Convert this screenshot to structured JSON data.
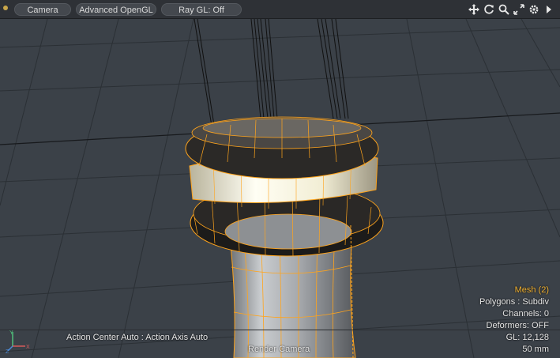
{
  "toolbar": {
    "camera_label": "Camera",
    "shading_label": "Advanced OpenGL",
    "raygl_label": "Ray GL: Off",
    "nav_icons": [
      "move-icon",
      "rotate-icon",
      "zoom-icon",
      "fit-icon",
      "settings-icon",
      "expand-arrow-icon"
    ]
  },
  "hud": {
    "mesh": "Mesh (2)",
    "polygons": "Polygons : Subdiv",
    "channels": "Channels: 0",
    "deformers": "Deformers: OFF",
    "gl": "GL: 12,128",
    "focal": "50 mm"
  },
  "status": {
    "action_center": "Action Center Auto : Action Axis Auto",
    "render_camera": "Render Camera"
  },
  "gizmo": {
    "x_label": "X",
    "y_label": "Y",
    "z_label": "Z"
  },
  "colors": {
    "viewport_bg": "#3b4148",
    "grid": "#2b3035",
    "wire_selected": "#ffa41c",
    "hud_accent": "#f0b030"
  }
}
